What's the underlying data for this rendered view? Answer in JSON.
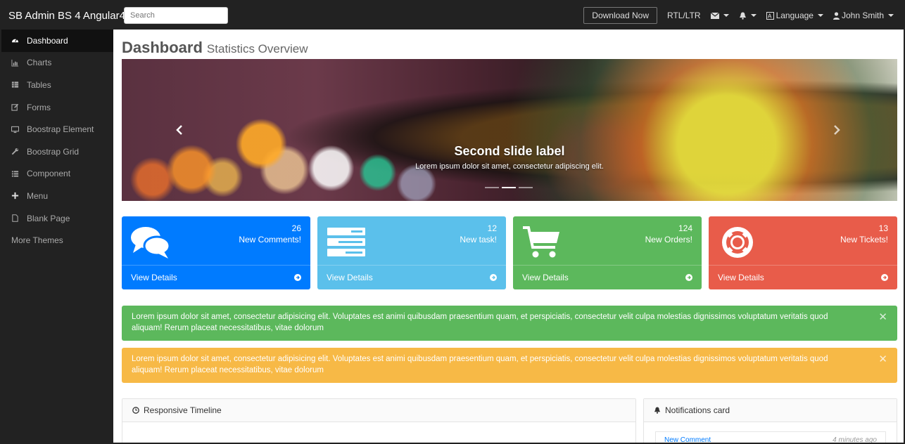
{
  "navbar": {
    "brand": "SB Admin BS 4 Angular4",
    "search_placeholder": "Search",
    "download_label": "Download Now",
    "rtl_label": "RTL/LTR",
    "language_label": "Language",
    "user_label": "John Smith"
  },
  "sidebar": {
    "items": [
      {
        "label": "Dashboard",
        "icon": "dashboard-icon"
      },
      {
        "label": "Charts",
        "icon": "bar-chart-icon"
      },
      {
        "label": "Tables",
        "icon": "table-icon"
      },
      {
        "label": "Forms",
        "icon": "edit-icon"
      },
      {
        "label": "Boostrap Element",
        "icon": "desktop-icon"
      },
      {
        "label": "Boostrap Grid",
        "icon": "wrench-icon"
      },
      {
        "label": "Component",
        "icon": "list-icon"
      },
      {
        "label": "Menu",
        "icon": "plus-icon"
      },
      {
        "label": "Blank Page",
        "icon": "file-icon"
      },
      {
        "label": "More Themes",
        "icon": ""
      }
    ]
  },
  "page": {
    "title": "Dashboard",
    "subtitle": "Statistics Overview"
  },
  "carousel": {
    "title": "Second slide label",
    "text": "Lorem ipsum dolor sit amet, consectetur adipiscing elit.",
    "active_slide": 2,
    "slide_count": 3
  },
  "cards": [
    {
      "count": "26",
      "label": "New Comments!",
      "link": "View Details",
      "color": "#007bff",
      "icon": "comments-icon"
    },
    {
      "count": "12",
      "label": "New task!",
      "link": "View Details",
      "color": "#5bc0eb",
      "icon": "tasks-icon"
    },
    {
      "count": "124",
      "label": "New Orders!",
      "link": "View Details",
      "color": "#5cb85c",
      "icon": "shopping-cart-icon"
    },
    {
      "count": "13",
      "label": "New Tickets!",
      "link": "View Details",
      "color": "#e85c4a",
      "icon": "life-ring-icon"
    }
  ],
  "alerts": [
    {
      "text": "Lorem ipsum dolor sit amet, consectetur adipisicing elit. Voluptates est animi quibusdam praesentium quam, et perspiciatis, consectetur velit culpa molestias dignissimos voluptatum veritatis quod aliquam! Rerum placeat necessitatibus, vitae dolorum",
      "color": "#5cb85c"
    },
    {
      "text": "Lorem ipsum dolor sit amet, consectetur adipisicing elit. Voluptates est animi quibusdam praesentium quam, et perspiciatis, consectetur velit culpa molestias dignissimos voluptatum veritatis quod aliquam! Rerum placeat necessitatibus, vitae dolorum",
      "color": "#f7b946"
    }
  ],
  "panels": {
    "timeline_title": "Responsive Timeline",
    "notifications_title": "Notifications card",
    "notification_item": "New Comment",
    "notification_time": "4 minutes ago"
  }
}
